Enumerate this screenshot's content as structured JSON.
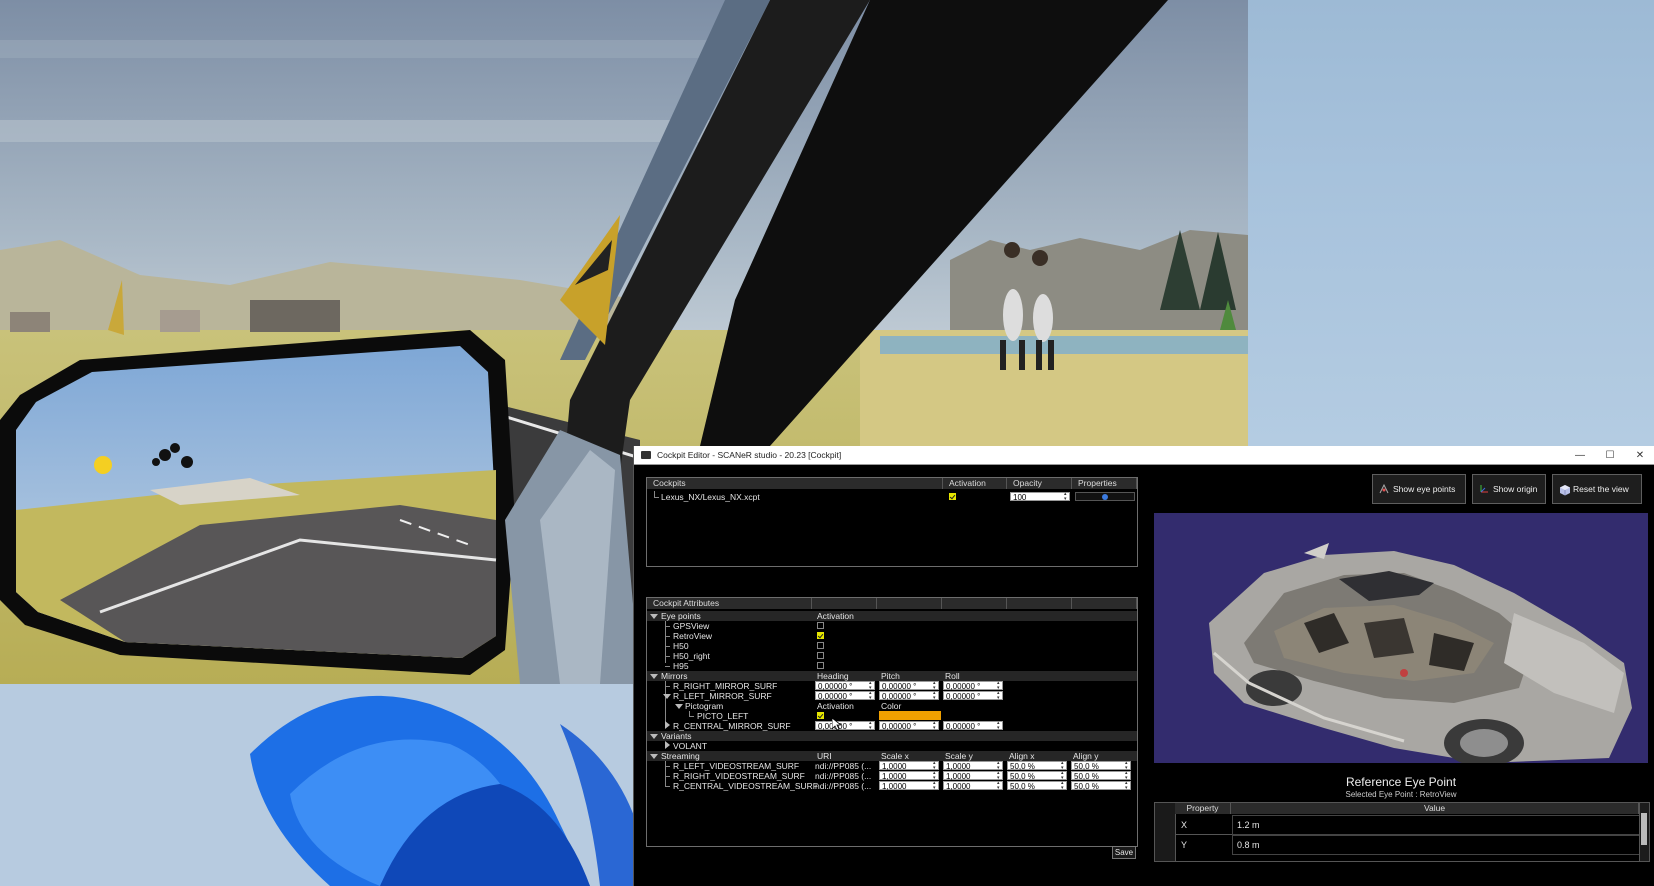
{
  "window": {
    "title": "Cockpit Editor - SCANeR studio - 20.23 [Cockpit]",
    "minimize": "—",
    "maximize": "☐",
    "close": "✕"
  },
  "cockpits": {
    "headers": [
      "Cockpits",
      "Activation",
      "Opacity",
      "Properties"
    ],
    "row": {
      "path": "Lexus_NX/Lexus_NX.xcpt",
      "activated": true,
      "opacity": "100"
    }
  },
  "attributes": {
    "title": "Cockpit Attributes",
    "eye_points": {
      "label": "Eye points",
      "col": "Activation",
      "items": [
        {
          "name": "GPSView",
          "on": false
        },
        {
          "name": "RetroView",
          "on": true
        },
        {
          "name": "H50",
          "on": false
        },
        {
          "name": "H50_right",
          "on": false
        },
        {
          "name": "H95",
          "on": false
        }
      ]
    },
    "mirrors": {
      "label": "Mirrors",
      "cols": [
        "Heading",
        "Pitch",
        "Roll"
      ],
      "right": {
        "name": "R_RIGHT_MIRROR_SURF",
        "heading": "0,00000 °",
        "pitch": "0,00000 °",
        "roll": "0,00000 °"
      },
      "left": {
        "name": "R_LEFT_MIRROR_SURF",
        "heading": "0,00000 °",
        "pitch": "0,00000 °",
        "roll": "0,00000 °"
      },
      "pictogram": {
        "label": "Pictogram",
        "col_activation": "Activation",
        "col_color": "Color",
        "item": "PICTO_LEFT",
        "on": true,
        "color": "#f0a000"
      },
      "central": {
        "name": "R_CENTRAL_MIRROR_SURF",
        "heading": "0,00000 °",
        "pitch": "0,00000 °",
        "roll": "0,00000 °"
      }
    },
    "variants": {
      "label": "Variants",
      "item": "VOLANT"
    },
    "streaming": {
      "label": "Streaming",
      "cols": [
        "URI",
        "Scale x",
        "Scale y",
        "Align x",
        "Align y"
      ],
      "items": [
        {
          "name": "R_LEFT_VIDEOSTREAM_SURF",
          "uri": "ndi://PP085 (...",
          "sx": "1,0000",
          "sy": "1,0000",
          "ax": "50,0 %",
          "ay": "50,0 %"
        },
        {
          "name": "R_RIGHT_VIDEOSTREAM_SURF",
          "uri": "ndi://PP085 (...",
          "sx": "1,0000",
          "sy": "1,0000",
          "ax": "50,0 %",
          "ay": "50,0 %"
        },
        {
          "name": "R_CENTRAL_VIDEOSTREAM_SURF",
          "uri": "ndi://PP085 (...",
          "sx": "1,0000",
          "sy": "1,0000",
          "ax": "50,0 %",
          "ay": "50,0 %"
        }
      ]
    }
  },
  "save_label": "Save",
  "toolbar": {
    "show_eye_points": "Show eye points",
    "show_origin": "Show origin",
    "reset_view": "Reset the view"
  },
  "reference": {
    "title": "Reference Eye Point",
    "subtitle": "Selected Eye Point : RetroView",
    "headers": [
      "Property",
      "Value"
    ],
    "rows": [
      {
        "property": "X",
        "value": "1.2 m"
      },
      {
        "property": "Y",
        "value": "0.8 m"
      }
    ]
  },
  "colors": {
    "viewport_bg": "#332c6e",
    "accent_yellow": "#e6e600",
    "picto_orange": "#f0a000"
  }
}
